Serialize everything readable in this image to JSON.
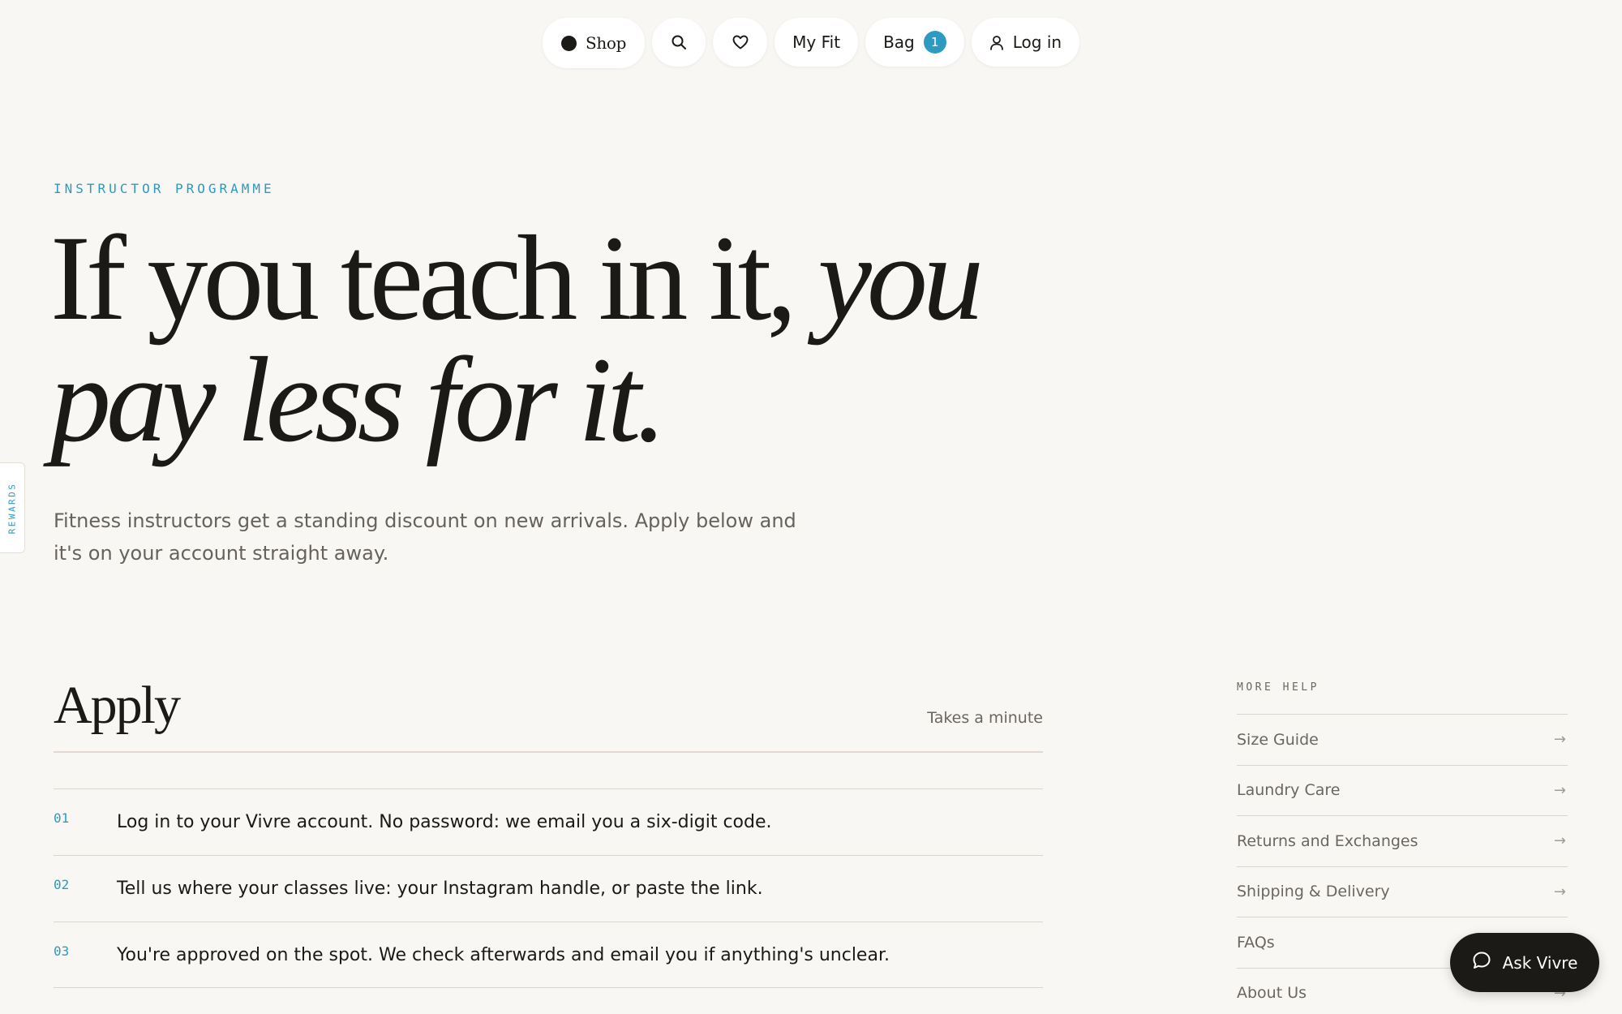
{
  "nav": {
    "shop_label": "Shop",
    "search_icon": "search-icon",
    "wishlist_icon": "heart-icon",
    "myfit_label": "My Fit",
    "bag_label": "Bag",
    "bag_count": "1",
    "login_label": "Log in",
    "login_icon": "user-icon"
  },
  "rewards_tab": {
    "label": "REWARDS"
  },
  "hero": {
    "eyebrow": "INSTRUCTOR PROGRAMME",
    "title_line1_plain": "If you teach in it, ",
    "title_line1_italic": "you",
    "title_line2_italic": "pay less for it.",
    "subtitle": "Fitness instructors get a standing discount on new arrivals. Apply below and it's on your account straight away."
  },
  "apply": {
    "heading": "Apply",
    "note": "Takes a minute",
    "steps": [
      {
        "num": "01",
        "text": "Log in to your Vivre account. No password: we email you a six-digit code."
      },
      {
        "num": "02",
        "text": "Tell us where your classes live: your Instagram handle, or paste the link."
      },
      {
        "num": "03",
        "text": "You're approved on the spot. We check afterwards and email you if anything's unclear."
      }
    ]
  },
  "more_help": {
    "title": "MORE HELP",
    "items": [
      {
        "label": "Size Guide",
        "arrow": "→"
      },
      {
        "label": "Laundry Care",
        "arrow": "→"
      },
      {
        "label": "Returns and Exchanges",
        "arrow": "→"
      },
      {
        "label": "Shipping & Delivery",
        "arrow": "→"
      },
      {
        "label": "FAQs",
        "arrow": "→"
      },
      {
        "label": "About Us",
        "arrow": "→"
      }
    ]
  },
  "chat": {
    "label": "Ask Vivre",
    "icon": "chat-bubble-icon"
  },
  "colors": {
    "background": "#f9f7f3",
    "accent": "#2d9ac2",
    "ink": "#1c1a16",
    "muted": "#6b6760"
  }
}
